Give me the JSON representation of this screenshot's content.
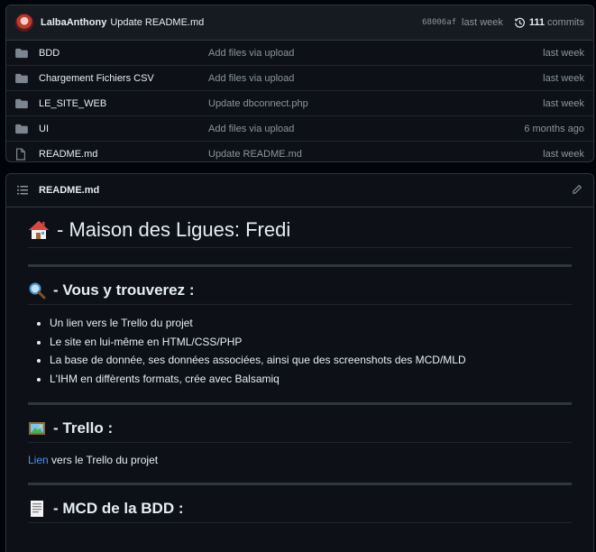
{
  "commit": {
    "author": "LalbaAnthony",
    "message": "Update README.md",
    "sha": "68006af",
    "time": "last week",
    "count": "111",
    "count_label": "commits"
  },
  "files": [
    {
      "name": "BDD",
      "type": "folder",
      "message": "Add files via upload",
      "time": "last week"
    },
    {
      "name": "Chargement Fichiers CSV",
      "type": "folder",
      "message": "Add files via upload",
      "time": "last week"
    },
    {
      "name": "LE_SITE_WEB",
      "type": "folder",
      "message": "Update dbconnect.php",
      "time": "last week"
    },
    {
      "name": "UI",
      "type": "folder",
      "message": "Add files via upload",
      "time": "6 months ago"
    },
    {
      "name": "README.md",
      "type": "file",
      "message": "Update README.md",
      "time": "last week"
    }
  ],
  "readme": {
    "filename": "README.md",
    "title": "- Maison des Ligues: Fredi",
    "section1": {
      "heading": "- Vous y trouverez :",
      "items": [
        "Un lien vers le Trello du projet",
        "Le site en lui-même en HTML/CSS/PHP",
        "La base de donnée, ses données associées, ainsi que des screenshots des MCD/MLD",
        "L'IHM en diffèrents formats, crée avec Balsamiq"
      ]
    },
    "section2": {
      "heading": "- Trello :",
      "link_text": "Lien",
      "rest_text": " vers le Trello du projet"
    },
    "section3": {
      "heading": "- MCD de la BDD :"
    }
  },
  "colors": {
    "background": "#0d1117",
    "border": "#30363d",
    "link": "#4493f8",
    "muted": "#8b949e",
    "folder": "#7d8590"
  }
}
